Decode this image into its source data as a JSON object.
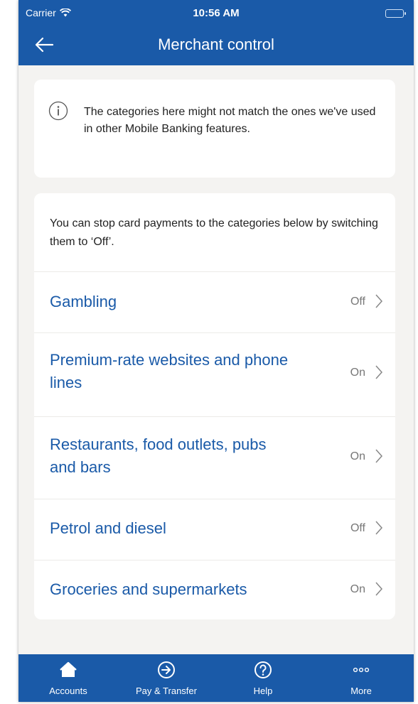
{
  "status_bar": {
    "carrier": "Carrier",
    "time": "10:56 AM"
  },
  "header": {
    "title": "Merchant control"
  },
  "info": {
    "text": "The categories here might not match the ones we've used in other Mobile Banking features."
  },
  "categories": {
    "intro": "You can stop card payments to the categories below by switching them to ‘Off’.",
    "items": [
      {
        "label": "Gambling",
        "status": "Off"
      },
      {
        "label": "Premium-rate websites and phone lines",
        "status": "On"
      },
      {
        "label": "Restaurants, food outlets, pubs and bars",
        "status": "On"
      },
      {
        "label": "Petrol and diesel",
        "status": "Off"
      },
      {
        "label": "Groceries and supermarkets",
        "status": "On"
      }
    ]
  },
  "tabbar": {
    "items": [
      {
        "label": "Accounts",
        "icon": "home-icon"
      },
      {
        "label": "Pay & Transfer",
        "icon": "arrow-circle-icon"
      },
      {
        "label": "Help",
        "icon": "question-circle-icon"
      },
      {
        "label": "More",
        "icon": "more-dots-icon"
      }
    ]
  },
  "colors": {
    "brand": "#1a5aa8",
    "background": "#f4f3f1",
    "card": "#ffffff"
  }
}
